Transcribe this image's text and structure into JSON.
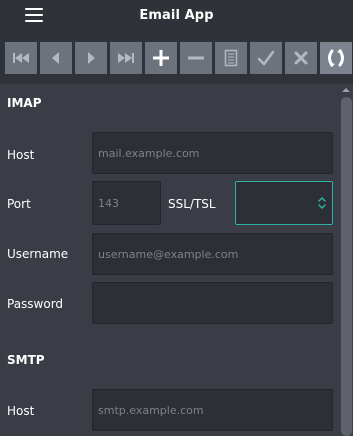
{
  "header": {
    "title": "Email App"
  },
  "toolbar": {
    "buttons": [
      {
        "name": "first-record-icon"
      },
      {
        "name": "previous-record-icon"
      },
      {
        "name": "next-record-icon"
      },
      {
        "name": "last-record-icon"
      },
      {
        "name": "add-record-icon"
      },
      {
        "name": "delete-record-icon"
      },
      {
        "name": "edit-record-icon"
      },
      {
        "name": "save-record-icon"
      },
      {
        "name": "cancel-edit-icon"
      },
      {
        "name": "refresh-icon"
      }
    ]
  },
  "imap": {
    "heading": "IMAP",
    "host_label": "Host",
    "host_placeholder": "mail.example.com",
    "port_label": "Port",
    "port_placeholder": "143",
    "ssl_label": "SSL/TSL",
    "ssl_value": "",
    "username_label": "Username",
    "username_placeholder": "username@example.com",
    "password_label": "Password",
    "password_placeholder": ""
  },
  "smtp": {
    "heading": "SMTP",
    "host_label": "Host",
    "host_placeholder": "smtp.example.com"
  },
  "colors": {
    "background": "#3a3d45",
    "bar": "#2f3238",
    "button": "#6d737d",
    "field": "#2c2f35",
    "focus_accent": "#2ab3a5"
  }
}
